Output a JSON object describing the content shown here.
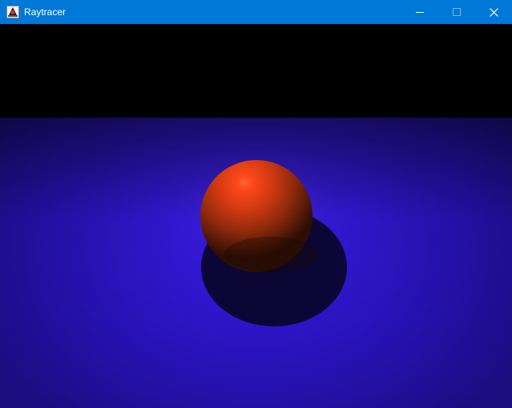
{
  "window": {
    "title": "Raytracer",
    "app_icon": "java-duke-icon",
    "controls": [
      "minimize-icon",
      "maximize-icon",
      "close-icon"
    ]
  },
  "colors": {
    "titlebar": "#0078d7",
    "sky": "#000000",
    "floor_lit": "#3a1bf0",
    "floor_dark": "#24129a",
    "shadow": "#0a0530",
    "sphere_highlight": "#ff5a2a",
    "sphere_base": "#c43a10",
    "sphere_dark": "#3a1206"
  },
  "scene": {
    "render_view": "raytraced-scene",
    "objects": [
      "floor-plane",
      "red-sphere",
      "sphere-shadow"
    ]
  }
}
